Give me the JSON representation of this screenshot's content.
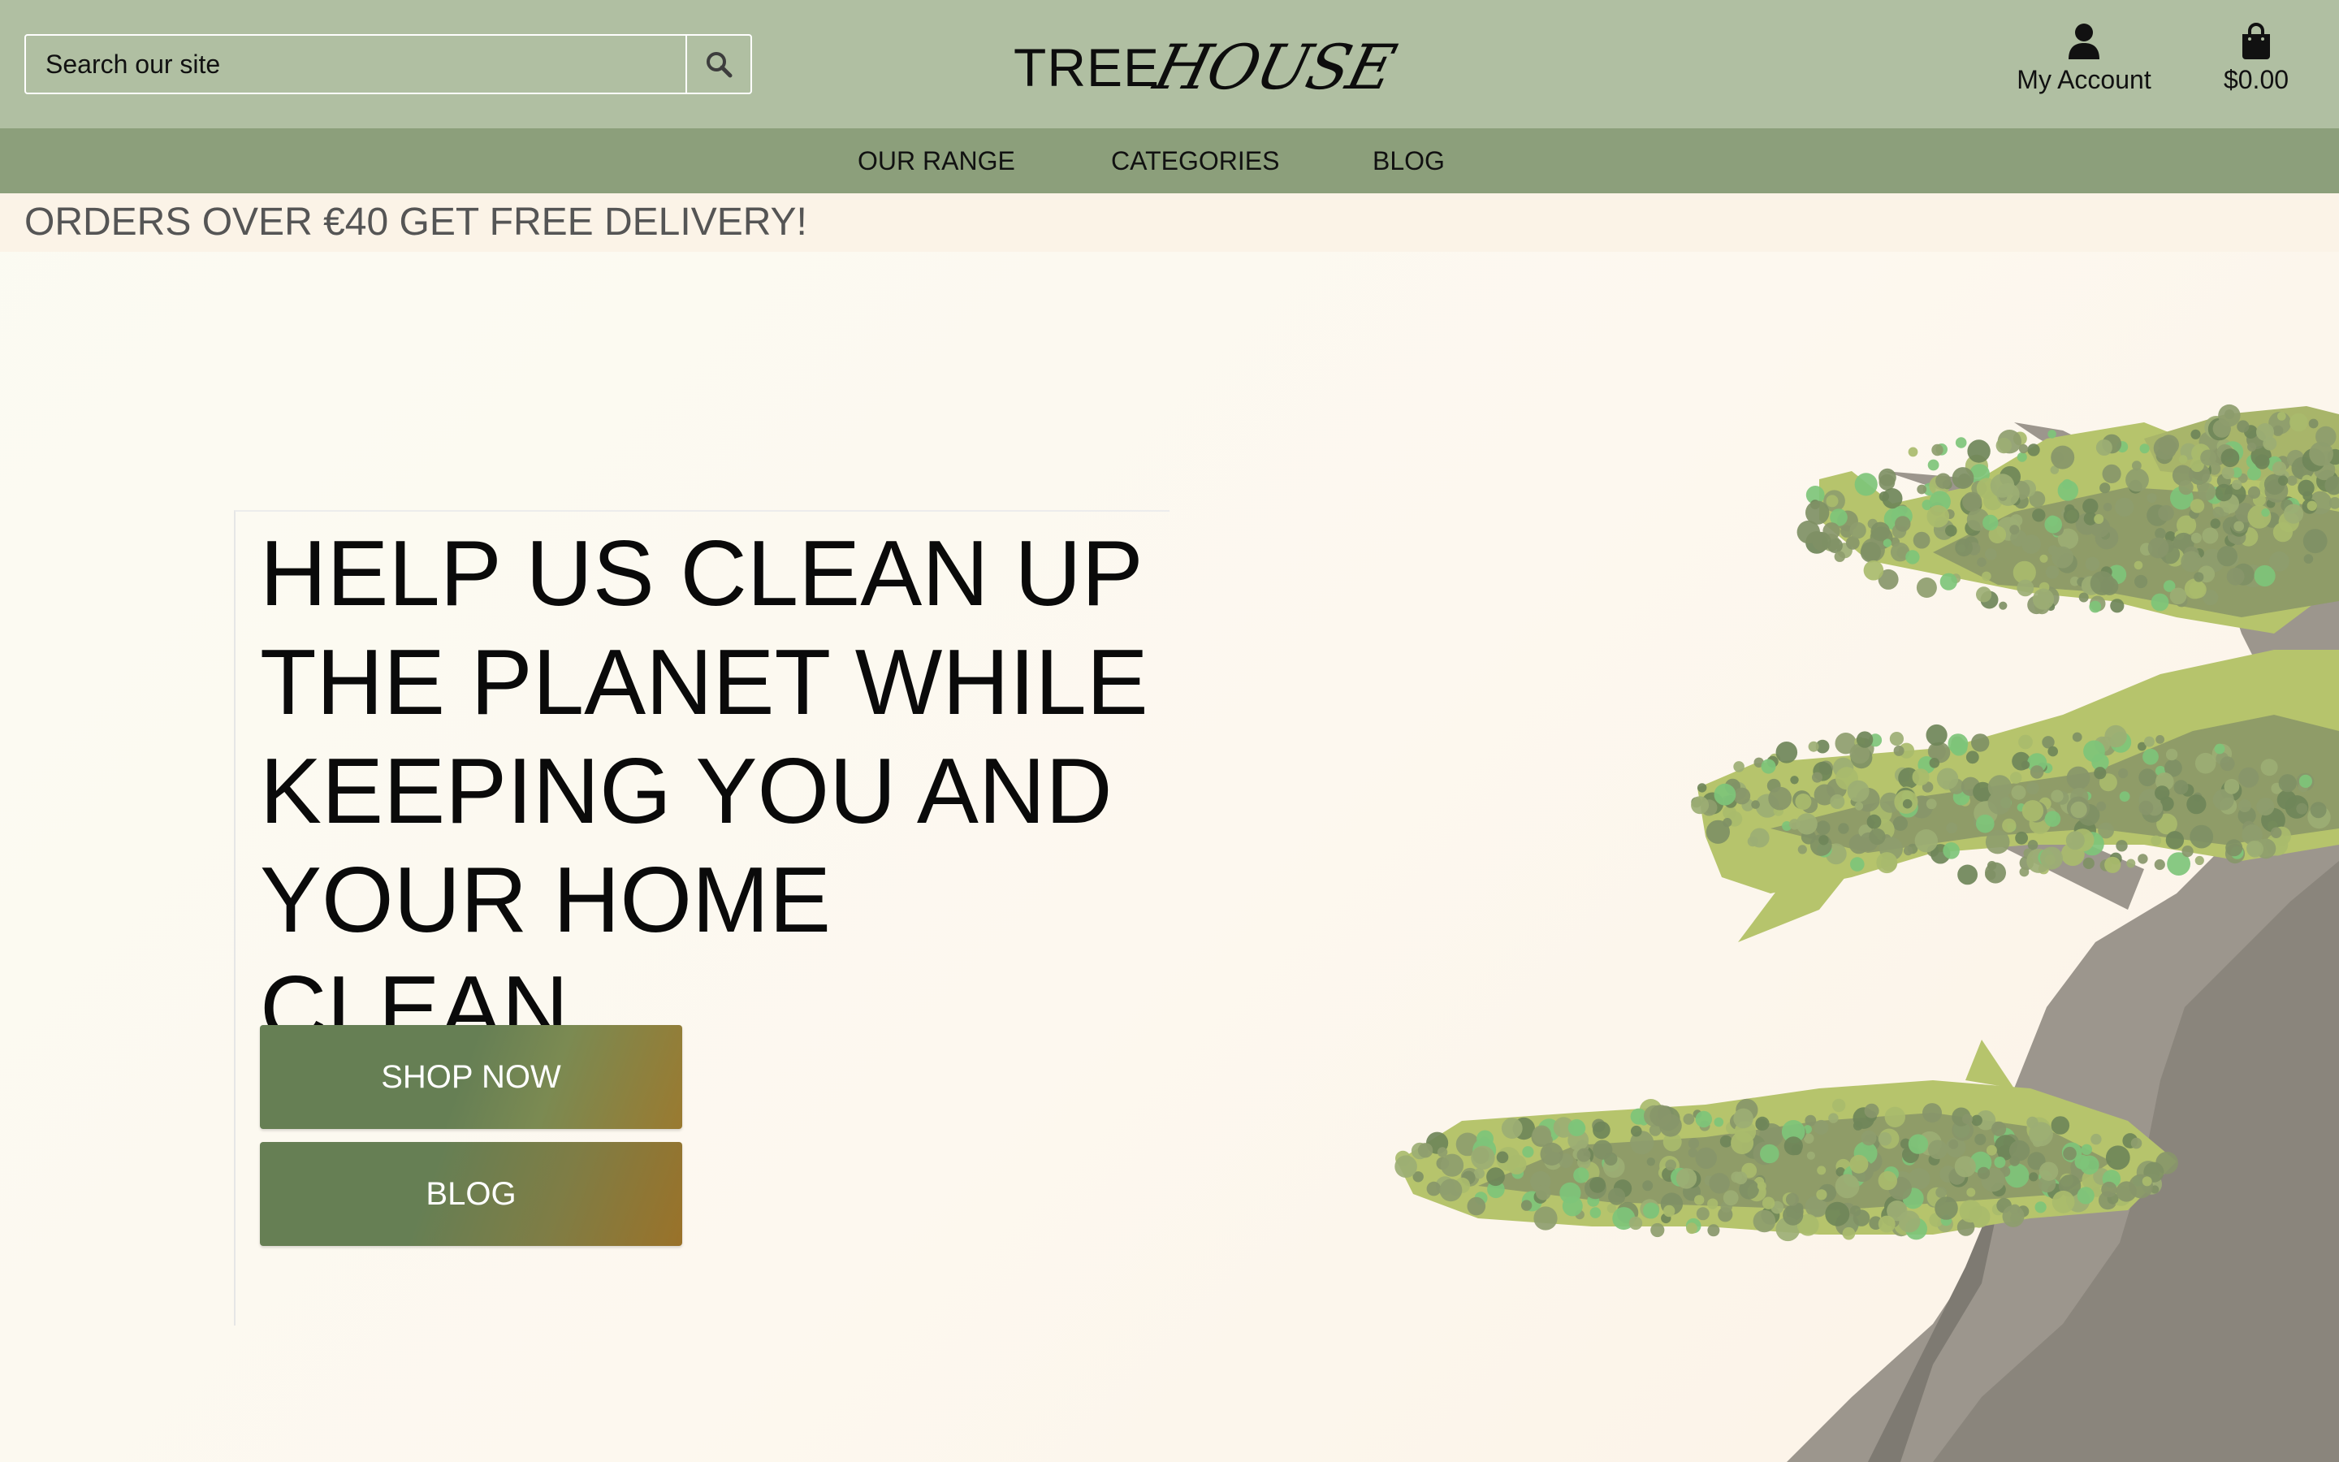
{
  "header": {
    "search": {
      "placeholder": "Search our site",
      "value": "",
      "button_icon": "search-icon"
    },
    "logo": {
      "part1": "TREE",
      "part2": "HOUSE"
    },
    "account": {
      "label": "My Account",
      "icon": "user-icon"
    },
    "cart": {
      "label": "$0.00",
      "icon": "shopping-bag-icon"
    }
  },
  "nav": {
    "items": [
      {
        "label": "OUR RANGE"
      },
      {
        "label": "CATEGORIES"
      },
      {
        "label": "BLOG"
      }
    ]
  },
  "banner": {
    "text": "ORDERS OVER €40 GET FREE DELIVERY!"
  },
  "hero": {
    "title": "HELP US CLEAN UP THE PLANET WHILE KEEPING YOU AND YOUR HOME CLEAN",
    "primary_button": "SHOP NOW",
    "secondary_button": "BLOG",
    "image": "bonsai-tree-illustration"
  },
  "colors": {
    "header_bg": "#b0bfa2",
    "nav_bg": "#8c9f7b",
    "banner_bg": "#fbf3e7",
    "button_green": "#667f54",
    "button_gold": "#9a7a30",
    "page_bg": "#fcf8f0"
  }
}
